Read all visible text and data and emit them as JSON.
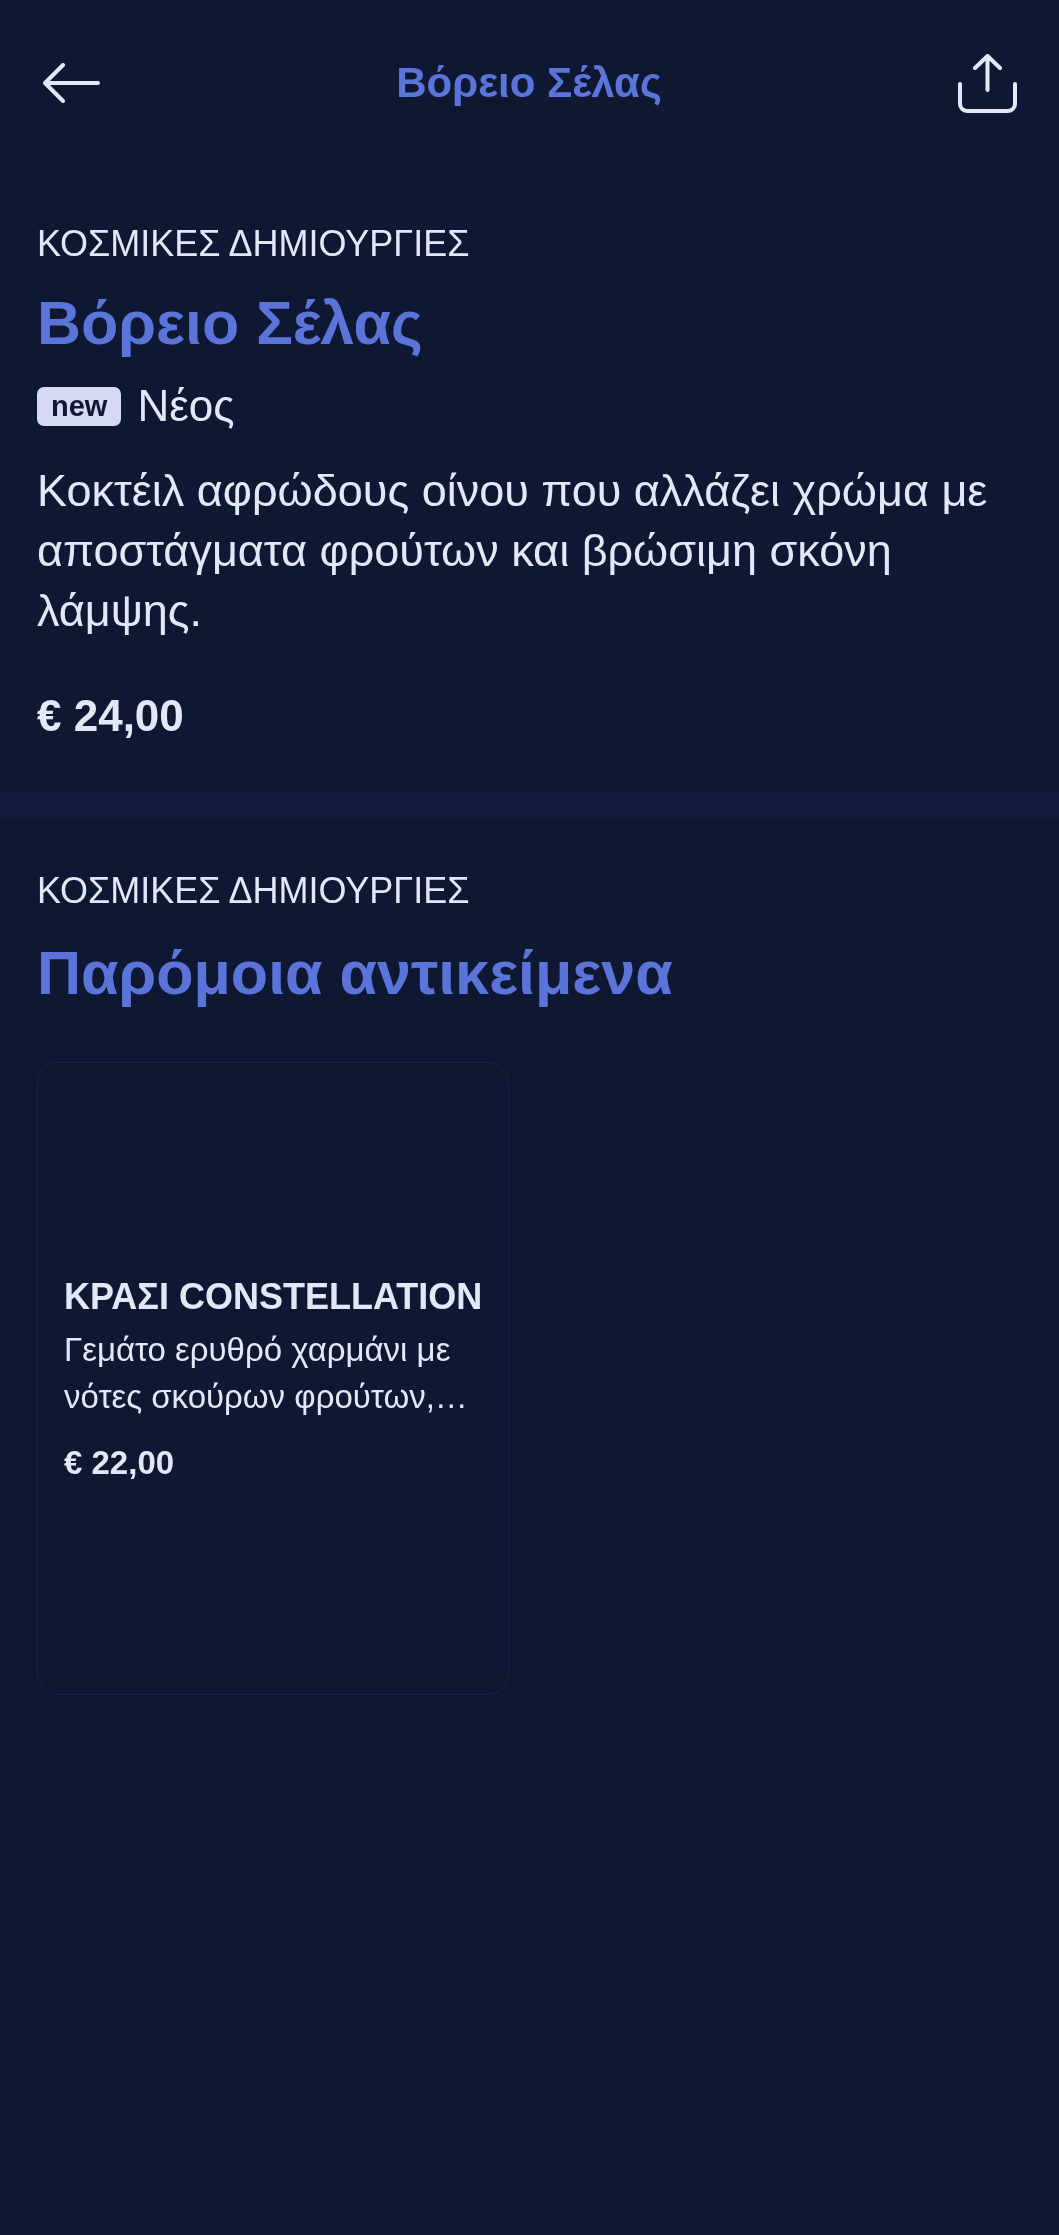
{
  "top_bar": {
    "title": "Βόρειο Σέλας"
  },
  "product": {
    "category": "ΚΟΣΜΙΚΕΣ ΔΗΜΙΟΥΡΓΙΕΣ",
    "name": "Βόρειο Σέλας",
    "badge": "new",
    "status": "Νέος",
    "description": "Κοκτέιλ αφρώδους οίνου που αλλάζει χρώμα με αποστάγματα φρούτων και βρώσιμη σκόνη λάμψης.",
    "price": "€ 24,00"
  },
  "similar": {
    "category": "ΚΟΣΜΙΚΕΣ ΔΗΜΙΟΥΡΓΙΕΣ",
    "heading": "Παρόμοια αντικείμενα",
    "items": [
      {
        "name": "ΚΡΑΣΙ CONSTELLATION",
        "description": "Γεμάτο ερυθρό χαρμάνι με νότες σκούρων φρούτων,…",
        "price": "€ 22,00"
      }
    ]
  }
}
